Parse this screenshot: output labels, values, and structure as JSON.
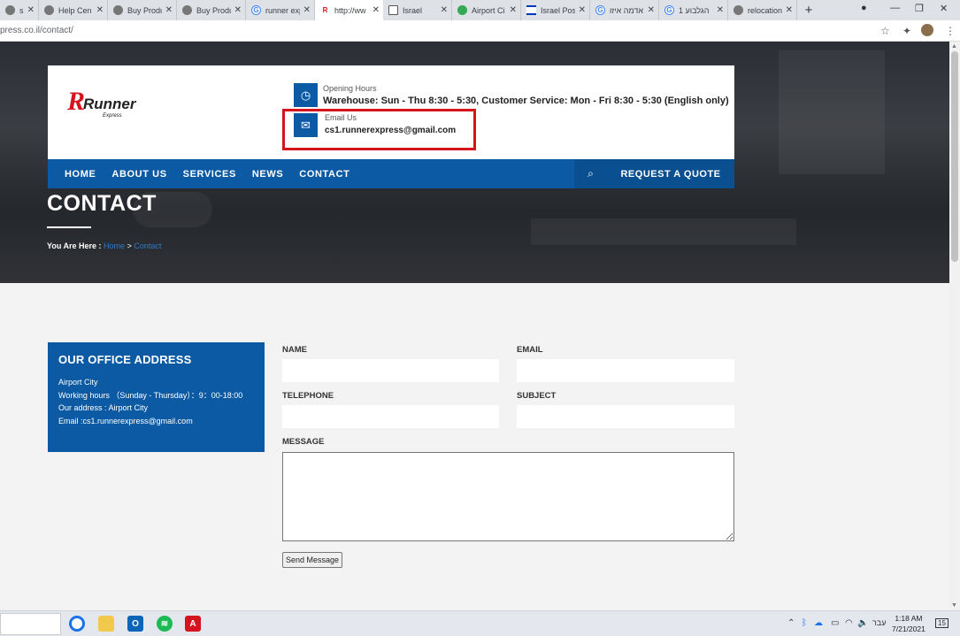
{
  "browser": {
    "tabs": [
      {
        "title": "sitokala",
        "icon": "page-icon",
        "active": false
      },
      {
        "title": "Help Cen",
        "icon": "help-icon",
        "active": false
      },
      {
        "title": "Buy Produ",
        "icon": "globe-icon",
        "active": false
      },
      {
        "title": "Buy Produ",
        "icon": "globe-icon",
        "active": false
      },
      {
        "title": "runner exp",
        "icon": "google-icon",
        "active": false
      },
      {
        "title": "http://ww",
        "icon": "runner-logo-icon",
        "active": true
      },
      {
        "title": "Israel",
        "icon": "mail-icon",
        "active": false
      },
      {
        "title": "Airport Ci",
        "icon": "maps-pin-icon",
        "active": false
      },
      {
        "title": "Israel Pos",
        "icon": "israel-flag-icon",
        "active": false
      },
      {
        "title": "אדמה איזו",
        "icon": "google-icon",
        "active": false
      },
      {
        "title": "הגלבוע 1",
        "icon": "google-icon",
        "active": false
      },
      {
        "title": "relocation",
        "icon": "globe-icon",
        "active": false
      }
    ],
    "new_tab": "+",
    "url": "press.co.il/contact/"
  },
  "site": {
    "opening_hours_label": "Opening Hours",
    "opening_hours_value": "Warehouse: Sun - Thu 8:30 - 5:30, Customer Service: Mon - Fri 8:30 - 5:30 (English only)",
    "email_label": "Email Us",
    "email_value": "cs1.runnerexpress@gmail.com",
    "logo_text": "Runner",
    "logo_sub": "Express",
    "nav": [
      "HOME",
      "ABOUT US",
      "SERVICES",
      "NEWS",
      "CONTACT"
    ],
    "quote_label": "REQUEST A QUOTE",
    "page_title": "CONTACT",
    "breadcrumb": {
      "prefix": "You Are Here :",
      "home": "Home",
      "sep": ">",
      "current": "Contact"
    },
    "office": {
      "heading": "OUR OFFICE ADDRESS",
      "line1": "Airport City",
      "line2": "Working hours （Sunday - Thursday）：9：00-18:00",
      "line3": "Our address : Airport City",
      "line4": "Email :cs1.runnerexpress@gmail.com"
    },
    "form": {
      "name_label": "NAME",
      "email_label": "EMAIL",
      "telephone_label": "TELEPHONE",
      "subject_label": "SUBJECT",
      "message_label": "MESSAGE",
      "send_label": "Send Message"
    }
  },
  "taskbar": {
    "language": "עבר",
    "time": "1:18 AM",
    "date": "7/21/2021",
    "notification_count": "15"
  },
  "colors": {
    "brand_blue": "#0b5aa3",
    "highlight_red": "#d6141d",
    "logo_red": "#d6141d"
  }
}
